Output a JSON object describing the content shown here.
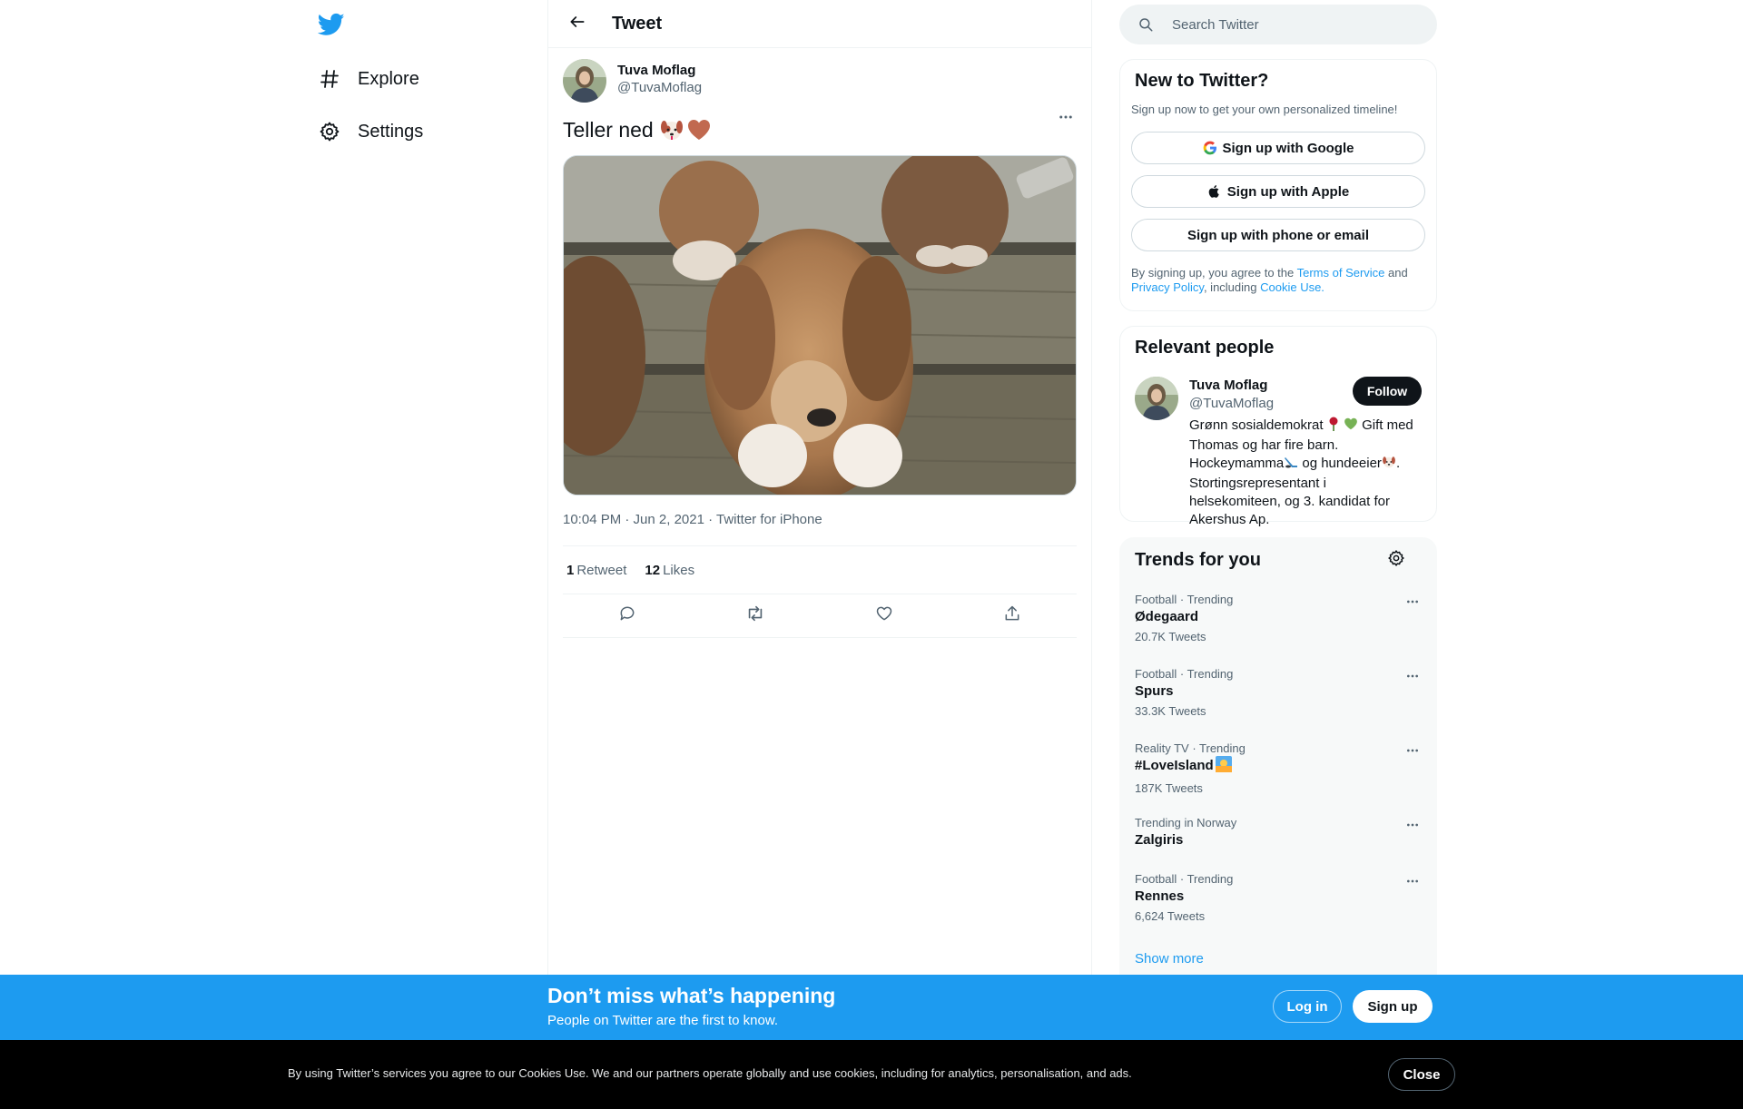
{
  "nav": {
    "logo_icon": "twitter-bird-icon",
    "items": [
      {
        "label": "Explore",
        "icon": "hashtag-icon"
      },
      {
        "label": "Settings",
        "icon": "gear-icon"
      }
    ]
  },
  "header": {
    "title": "Tweet"
  },
  "tweet": {
    "author_name": "Tuva Moflag",
    "author_handle": "@TuvaMoflag",
    "text": "Teller ned",
    "emojis": [
      "dog-face-emoji",
      "brown-heart-emoji"
    ],
    "timestamp": "10:04 PM · Jun 2, 2021 · Twitter for iPhone",
    "retweets_count": "1",
    "retweets_label": "Retweet",
    "likes_count": "12",
    "likes_label": "Likes",
    "actions": [
      "reply-icon",
      "retweet-icon",
      "like-icon",
      "share-icon"
    ]
  },
  "search": {
    "placeholder": "Search Twitter"
  },
  "new_to_twitter": {
    "title": "New to Twitter?",
    "subtitle": "Sign up now to get your own personalized timeline!",
    "google_label": "Sign up with Google",
    "apple_label": "Sign up with Apple",
    "phone_label": "Sign up with phone or email",
    "legal_prefix": "By signing up, you agree to the ",
    "terms_link": "Terms of Service",
    "legal_and": " and",
    "privacy_link": "Privacy Policy",
    "legal_including": ", including ",
    "cookie_link": "Cookie Use."
  },
  "relevant": {
    "title": "Relevant people",
    "name": "Tuva Moflag",
    "handle": "@TuvaMoflag",
    "follow_label": "Follow",
    "bio_1": "Grønn sosialdemokrat",
    "bio_2": " Gift med Thomas og har fire barn. Hockeymamma",
    "bio_3": " og hundeeier",
    "bio_4": ". Stortingsrepresentant i helsekomiteen, og 3. kandidat for Akershus Ap."
  },
  "trends": {
    "title": "Trends for you",
    "items": [
      {
        "meta": "Football · Trending",
        "name": "Ødegaard",
        "count": "20.7K Tweets"
      },
      {
        "meta": "Football · Trending",
        "name": "Spurs",
        "count": "33.3K Tweets"
      },
      {
        "meta": "Reality TV · Trending",
        "name": "#LoveIsland",
        "count": "187K Tweets"
      },
      {
        "meta": "Trending in Norway",
        "name": "Zalgiris",
        "count": ""
      },
      {
        "meta": "Football · Trending",
        "name": "Rennes",
        "count": "6,624 Tweets"
      }
    ],
    "show_more": "Show more"
  },
  "banner": {
    "title": "Don’t miss what’s happening",
    "subtitle": "People on Twitter are the first to know.",
    "login_label": "Log in",
    "signup_label": "Sign up"
  },
  "cookie": {
    "text": "By using Twitter’s services you agree to our Cookies Use. We and our partners operate globally and use cookies, including for analytics, personalisation, and ads.",
    "close_label": "Close"
  },
  "colors": {
    "brand": "#1d9bf0",
    "text": "#0f1419",
    "muted": "#536471"
  }
}
